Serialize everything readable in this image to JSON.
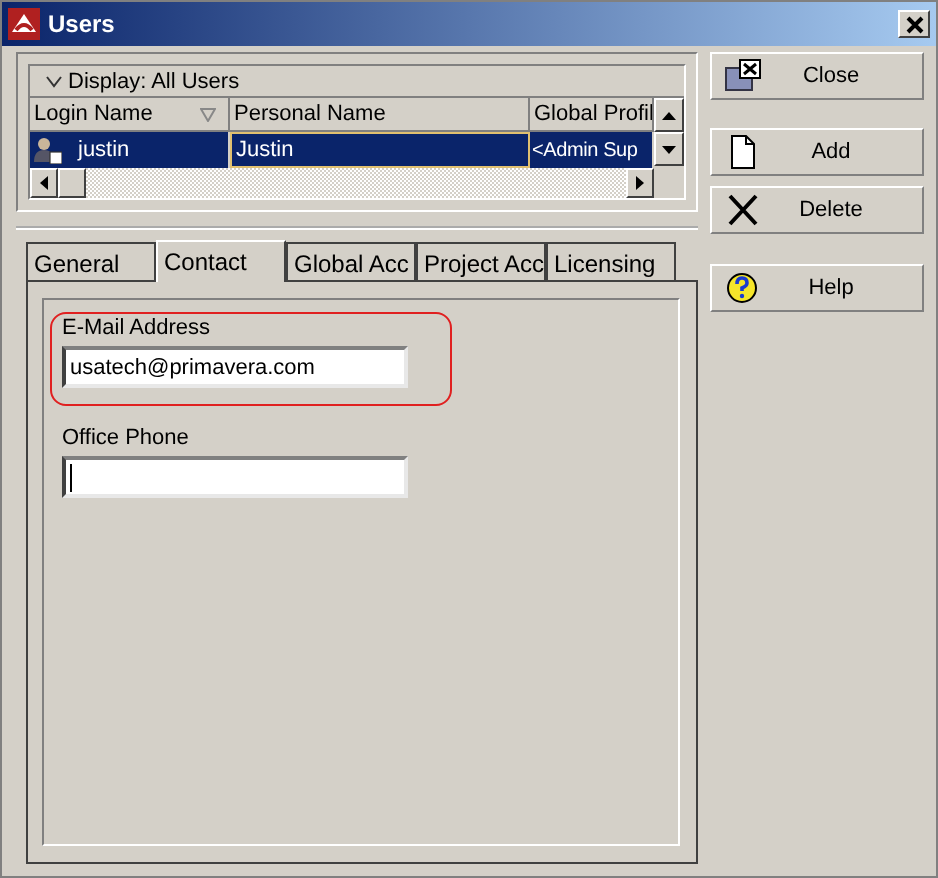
{
  "window": {
    "title": "Users"
  },
  "grid": {
    "display_label": "Display: All Users",
    "columns": [
      {
        "label": "Login Name",
        "sorted": true
      },
      {
        "label": "Personal Name",
        "sorted": false
      },
      {
        "label": "Global Profil",
        "sorted": false
      }
    ],
    "rows": [
      {
        "selected": true,
        "cells": [
          "justin",
          "Justin",
          "<Admin Sup"
        ]
      }
    ]
  },
  "tabs": [
    {
      "label": "General",
      "selected": false
    },
    {
      "label": "Contact",
      "selected": true
    },
    {
      "label": "Global Acc",
      "selected": false
    },
    {
      "label": "Project Acc",
      "selected": false
    },
    {
      "label": "Licensing",
      "selected": false
    }
  ],
  "fields": [
    {
      "label": "E-Mail Address",
      "value": "usatech@primavera.com",
      "highlighted": true,
      "focused": false
    },
    {
      "label": "Office Phone",
      "highlighted": false,
      "focused": true
    }
  ],
  "buttons": [
    {
      "label": "Close",
      "kind": "close"
    },
    {
      "label": "Add",
      "kind": "add"
    },
    {
      "label": "Delete",
      "kind": "delete"
    },
    {
      "label": "Help",
      "kind": "help"
    }
  ]
}
